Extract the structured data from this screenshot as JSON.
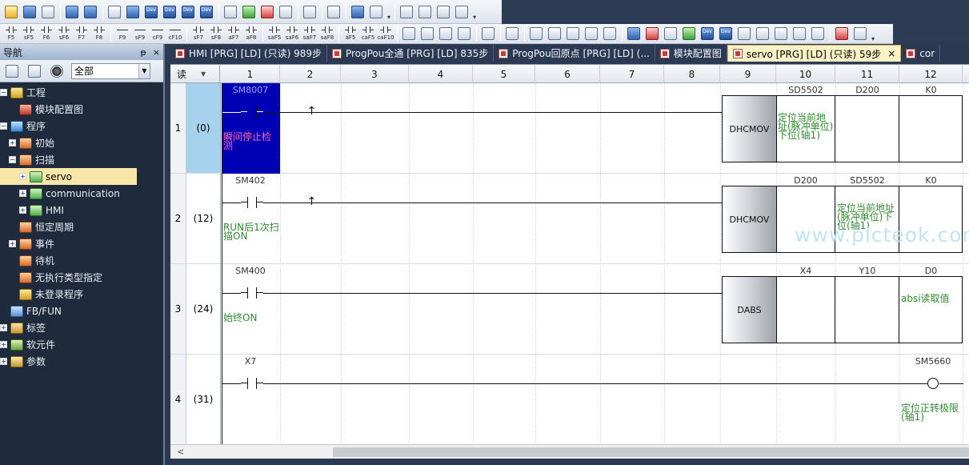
{
  "toolbar2_labels": [
    "F5",
    "sF5",
    "F6",
    "sF6",
    "F7",
    "F8",
    "F9",
    "sF9",
    "cF9",
    "cF10",
    "sF7",
    "sF8",
    "aF7",
    "aF8",
    "saF5",
    "saF6",
    "saF7",
    "saF8",
    "aF5",
    "caF5",
    "caF10"
  ],
  "nav": {
    "title": "导航",
    "pin_label": "ᵽ",
    "close_label": "×",
    "filter_value": "全部",
    "tree": [
      {
        "label": "工程",
        "indent": 0,
        "expander": "-",
        "icon": "proj"
      },
      {
        "label": "模块配置图",
        "indent": 1,
        "expander": "",
        "icon": "mod"
      },
      {
        "label": "程序",
        "indent": 0,
        "expander": "-",
        "icon": "prg"
      },
      {
        "label": "初始",
        "indent": 1,
        "expander": "+",
        "icon": "book"
      },
      {
        "label": "扫描",
        "indent": 1,
        "expander": "-",
        "icon": "book"
      },
      {
        "label": "servo",
        "indent": 2,
        "expander": "+",
        "icon": "scan",
        "selected": true
      },
      {
        "label": "communication",
        "indent": 2,
        "expander": "+",
        "icon": "scan"
      },
      {
        "label": "HMI",
        "indent": 2,
        "expander": "+",
        "icon": "scan"
      },
      {
        "label": "恒定周期",
        "indent": 1,
        "expander": "",
        "icon": "book"
      },
      {
        "label": "事件",
        "indent": 1,
        "expander": "+",
        "icon": "book"
      },
      {
        "label": "待机",
        "indent": 1,
        "expander": "",
        "icon": "book"
      },
      {
        "label": "无执行类型指定",
        "indent": 1,
        "expander": "",
        "icon": "book"
      },
      {
        "label": "未登录程序",
        "indent": 1,
        "expander": "",
        "icon": "proj"
      },
      {
        "label": "FB/FUN",
        "indent": 0,
        "expander": "",
        "icon": "fb"
      },
      {
        "label": "标签",
        "indent": 0,
        "expander": "+",
        "icon": "lbl"
      },
      {
        "label": "软元件",
        "indent": 0,
        "expander": "+",
        "icon": "dev"
      },
      {
        "label": "参数",
        "indent": 0,
        "expander": "+",
        "icon": "prm"
      }
    ]
  },
  "tabs": [
    {
      "label": "HMI [PRG] [LD] (只读) 989步",
      "active": false
    },
    {
      "label": "ProgPou全通 [PRG] [LD] 835步",
      "active": false
    },
    {
      "label": "ProgPou回原点 [PRG] [LD] (...",
      "active": false
    },
    {
      "label": "模块配置图",
      "active": false
    },
    {
      "label": "servo [PRG] [LD] (只读) 59步",
      "active": true
    },
    {
      "label": "cor",
      "active": false
    }
  ],
  "editor": {
    "read_mode": "读",
    "columns": [
      "1",
      "2",
      "3",
      "4",
      "5",
      "6",
      "7",
      "8",
      "9",
      "10",
      "11",
      "12"
    ],
    "watermark": "www.plcteok.com",
    "rungs": [
      {
        "row": "1",
        "step": "(0)",
        "contact_device": "SM8007",
        "contact_comment": "瞬间停止检测",
        "rising": true,
        "instruction": "DHCMOV",
        "operands": [
          "SD5502",
          "D200",
          "K0"
        ],
        "operand_comments": [
          "定位当前地址(脉冲单位)下位(轴1)",
          "",
          ""
        ]
      },
      {
        "row": "2",
        "step": "(12)",
        "contact_device": "SM402",
        "contact_comment": "RUN后1次扫描ON",
        "rising": true,
        "instruction": "DHCMOV",
        "operands": [
          "D200",
          "SD5502",
          "K0"
        ],
        "operand_comments": [
          "",
          "定位当前地址(脉冲单位)下位(轴1)",
          ""
        ]
      },
      {
        "row": "3",
        "step": "(24)",
        "contact_device": "SM400",
        "contact_comment": "始终ON",
        "rising": false,
        "instruction": "DABS",
        "operands": [
          "X4",
          "Y10",
          "D0"
        ],
        "operand_comments": [
          "",
          "",
          "absi读取值"
        ]
      },
      {
        "row": "4",
        "step": "(31)",
        "contact_device": "X7",
        "contact_comment": "",
        "rising": false,
        "coil_device": "SM5660",
        "coil_comment": "定位正转极限(轴1)"
      }
    ]
  },
  "colors": {
    "selection_block": "#0000b4",
    "comment_green": "#2e8b2e",
    "comment_pink": "#ff6aa8",
    "tab_active": "#fbf3c6",
    "tree_selected": "#f8e7a8"
  }
}
